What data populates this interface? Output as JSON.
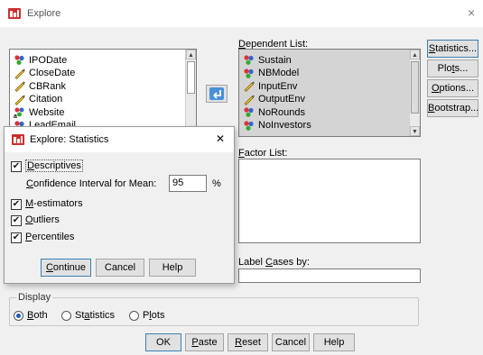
{
  "window": {
    "title": "Explore",
    "close_glyph": "×",
    "icon": "spss-icon"
  },
  "source_vars": [
    {
      "label": "IPODate",
      "icon": "nominal-icon"
    },
    {
      "label": "CloseDate",
      "icon": "scale-icon"
    },
    {
      "label": "CBRank",
      "icon": "scale-icon"
    },
    {
      "label": "Citation",
      "icon": "scale-icon"
    },
    {
      "label": "Website",
      "icon": "string-icon"
    },
    {
      "label": "LeadEmail",
      "icon": "nominal-icon"
    }
  ],
  "move_button": {
    "icon": "arrow-right-icon"
  },
  "dependent": {
    "label_pre": "",
    "label_u": "D",
    "label_post": "ependent List:",
    "items": [
      {
        "label": "Sustain",
        "icon": "nominal-icon"
      },
      {
        "label": "NBModel",
        "icon": "nominal-icon"
      },
      {
        "label": "InputEnv",
        "icon": "scale-icon"
      },
      {
        "label": "OutputEnv",
        "icon": "scale-icon"
      },
      {
        "label": "NoRounds",
        "icon": "nominal-icon"
      },
      {
        "label": "NoInvestors",
        "icon": "nominal-icon"
      }
    ]
  },
  "factor": {
    "label_pre": "",
    "label_u": "F",
    "label_post": "actor List:"
  },
  "label_cases": {
    "label_pre": "Label ",
    "label_u": "C",
    "label_post": "ases by:"
  },
  "side_buttons": [
    {
      "pre": "",
      "u": "S",
      "post": "tatistics..."
    },
    {
      "pre": "Plo",
      "u": "t",
      "post": "s..."
    },
    {
      "pre": "",
      "u": "O",
      "post": "ptions..."
    },
    {
      "pre": "",
      "u": "B",
      "post": "ootstrap..."
    }
  ],
  "display": {
    "legend": "Display",
    "options": [
      {
        "pre": "",
        "u": "B",
        "post": "oth",
        "selected": true
      },
      {
        "pre": "St",
        "u": "a",
        "post": "tistics",
        "selected": false
      },
      {
        "pre": "P",
        "u": "l",
        "post": "ots",
        "selected": false
      }
    ]
  },
  "bottom_buttons": [
    {
      "pre": "OK",
      "u": "",
      "post": ""
    },
    {
      "pre": "",
      "u": "P",
      "post": "aste"
    },
    {
      "pre": "",
      "u": "R",
      "post": "eset"
    },
    {
      "pre": "Cancel",
      "u": "",
      "post": ""
    },
    {
      "pre": "Help",
      "u": "",
      "post": ""
    }
  ],
  "stats_dialog": {
    "title": "Explore: Statistics",
    "close_glyph": "✕",
    "descriptives": {
      "pre": "",
      "u": "D",
      "post": "escriptives",
      "checked": true
    },
    "ci_label": {
      "pre": "",
      "u": "C",
      "post": "onfidence Interval for Mean:"
    },
    "ci_value": "95",
    "ci_unit": "%",
    "m_estimators": {
      "pre": "",
      "u": "M",
      "post": "-estimators",
      "checked": true
    },
    "outliers": {
      "pre": "",
      "u": "O",
      "post": "utliers",
      "checked": true
    },
    "percentiles": {
      "pre": "",
      "u": "P",
      "post": "ercentiles",
      "checked": true
    },
    "check_glyph": "✔",
    "buttons": [
      {
        "pre": "",
        "u": "C",
        "post": "ontinue"
      },
      {
        "pre": "Cancel",
        "u": "",
        "post": ""
      },
      {
        "pre": "Help",
        "u": "",
        "post": ""
      }
    ]
  },
  "colors": {
    "accent": "#3c7fb1",
    "list_selected_bg": "#d4d4d4",
    "move_button": "#4a90d9"
  }
}
